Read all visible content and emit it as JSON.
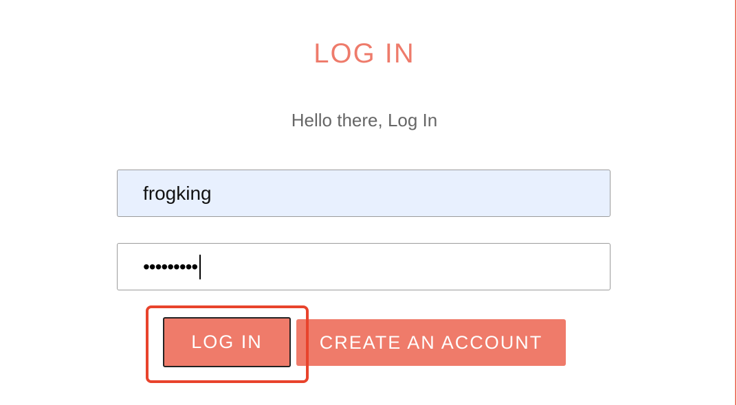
{
  "page": {
    "title": "LOG IN",
    "subtitle": "Hello there, Log In"
  },
  "form": {
    "username_value": "frogking",
    "password_mask": "•••••••••"
  },
  "buttons": {
    "login_label": "LOG IN",
    "create_label": "CREATE AN ACCOUNT"
  },
  "colors": {
    "accent": "#ef7b6a",
    "highlight": "#e8432c",
    "autofill_bg": "#e8f0fe"
  }
}
